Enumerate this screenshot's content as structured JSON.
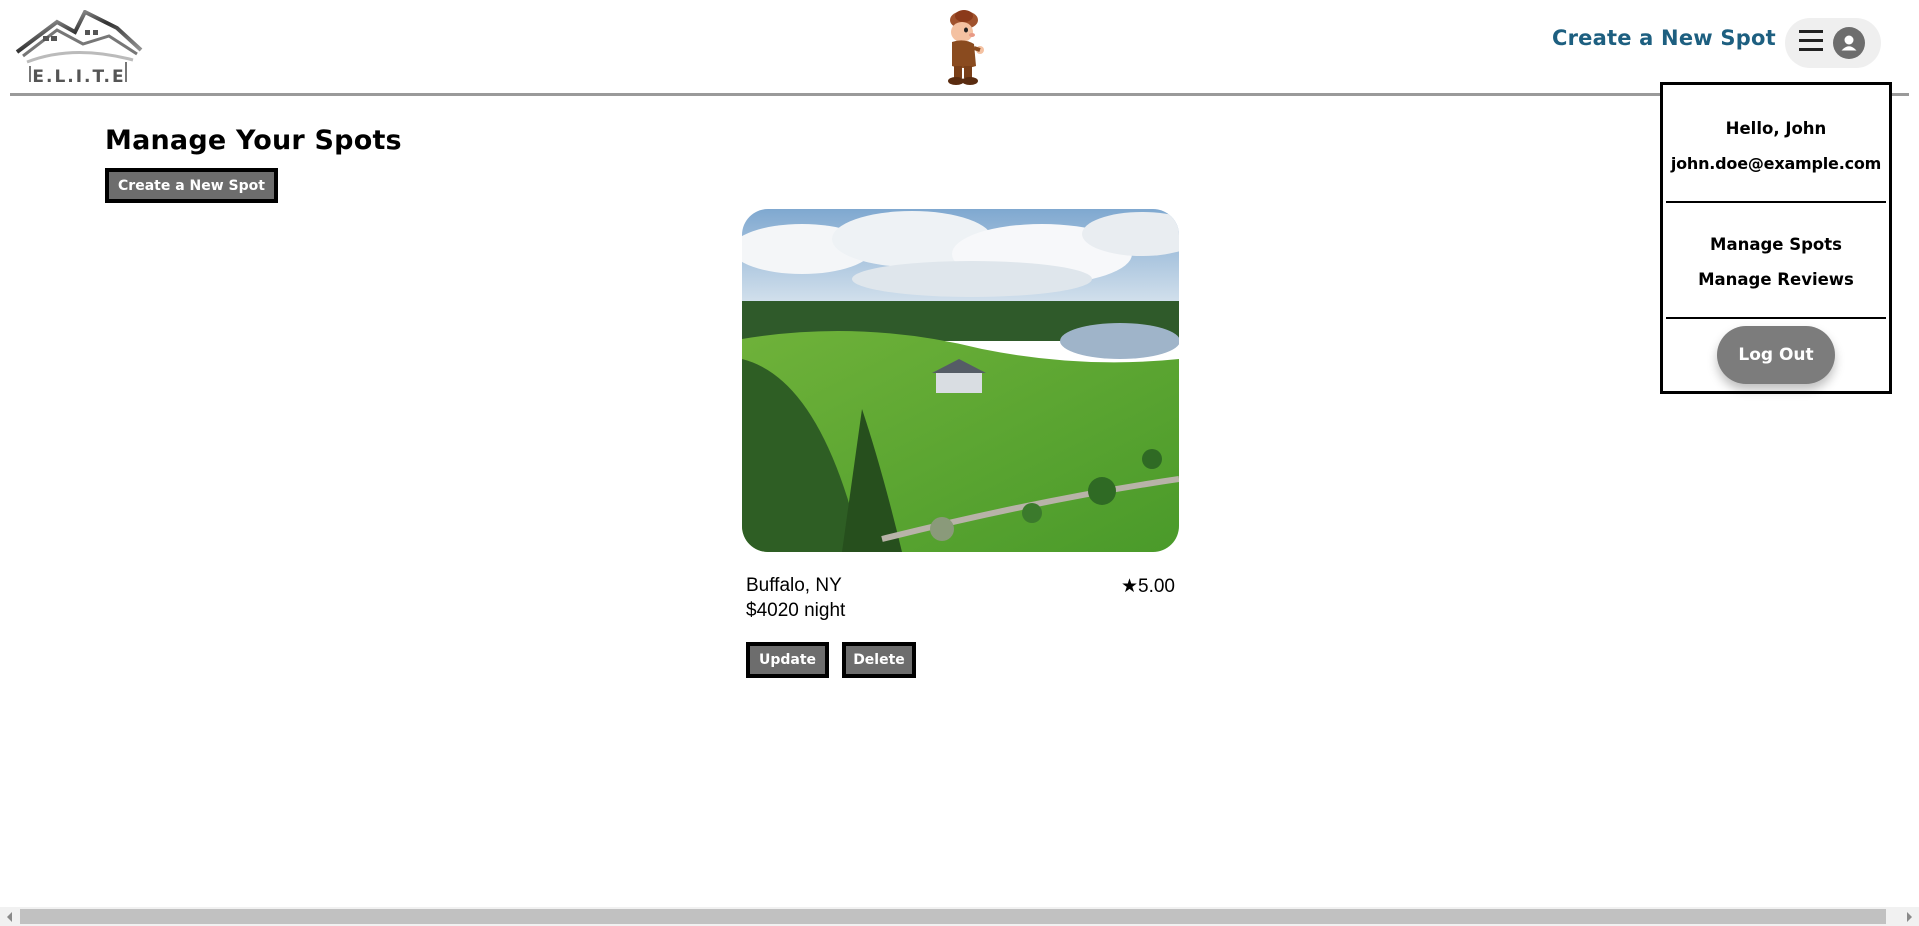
{
  "header": {
    "logo_text": "E.L.I.T.E",
    "create_link": "Create a New Spot",
    "menu_icon": "hamburger-icon",
    "avatar_icon": "user-avatar-icon"
  },
  "dropdown": {
    "greeting": "Hello, John",
    "email": "john.doe@example.com",
    "links": [
      "Manage Spots",
      "Manage Reviews"
    ],
    "logout": "Log Out"
  },
  "main": {
    "title": "Manage Your Spots",
    "create_button": "Create a New Spot",
    "spots": [
      {
        "location": "Buffalo, NY",
        "price": "$4020 night",
        "rating": "5.00",
        "update_label": "Update",
        "delete_label": "Delete"
      }
    ]
  },
  "colors": {
    "accent": "#1d5f80",
    "button": "#6d6d6d",
    "logout": "#7c7c7c"
  }
}
